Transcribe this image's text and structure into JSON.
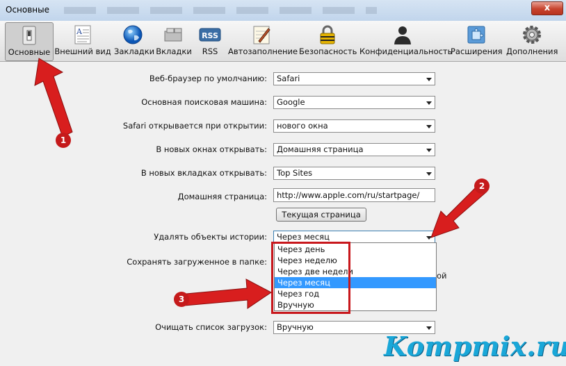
{
  "window": {
    "title": "Основные",
    "close_symbol": "x"
  },
  "toolbar": {
    "tabs": [
      {
        "label": "Основные",
        "icon": "light-switch-icon",
        "active": true
      },
      {
        "label": "Внешний вид",
        "icon": "text-document-icon",
        "active": false
      },
      {
        "label": "Закладки",
        "icon": "globe-icon",
        "active": false
      },
      {
        "label": "Вкладки",
        "icon": "tabs-tray-icon",
        "active": false
      },
      {
        "label": "RSS",
        "icon": "rss-icon",
        "active": false
      },
      {
        "label": "Автозаполнение",
        "icon": "pen-pad-icon",
        "active": false
      },
      {
        "label": "Безопасность",
        "icon": "padlock-icon",
        "active": false
      },
      {
        "label": "Конфиденциальность",
        "icon": "person-silhouette-icon",
        "active": false
      },
      {
        "label": "Расширения",
        "icon": "puzzle-icon",
        "active": false
      },
      {
        "label": "Дополнения",
        "icon": "gear-icon",
        "active": false
      }
    ],
    "rss_text": "RSS"
  },
  "settings": {
    "default_browser": {
      "label": "Веб-браузер по умолчанию:",
      "value": "Safari"
    },
    "search_engine": {
      "label": "Основная поисковая машина:",
      "value": "Google"
    },
    "safari_opens": {
      "label": "Safari открывается при открытии:",
      "value": "нового окна"
    },
    "new_windows": {
      "label": "В новых окнах открывать:",
      "value": "Домашняя страница"
    },
    "new_tabs": {
      "label": "В новых вкладках открывать:",
      "value": "Top Sites"
    },
    "homepage": {
      "label": "Домашняя страница:",
      "value": "http://www.apple.com/ru/startpage/"
    },
    "current_page_button": "Текущая страница",
    "remove_history": {
      "label": "Удалять объекты истории:",
      "value": "Через месяц"
    },
    "save_downloads": {
      "label": "Сохранять загруженное в папке:"
    },
    "clip_text": "ой",
    "clear_downloads": {
      "label": "Очищать список загрузок:",
      "value": "Вручную"
    }
  },
  "history_dropdown": {
    "options": [
      "Через день",
      "Через неделю",
      "Через две недели",
      "Через месяц",
      "Через год",
      "Вручную"
    ],
    "selected": "Через месяц"
  },
  "annotations": {
    "badge1": "1",
    "badge2": "2",
    "badge3": "3",
    "arrow_color": "#d81e1e"
  },
  "watermark": "Kompmix.ru",
  "colors": {
    "selection": "#3399ff",
    "highlight_box": "#c8171c",
    "watermark": "#1aa7d8"
  }
}
